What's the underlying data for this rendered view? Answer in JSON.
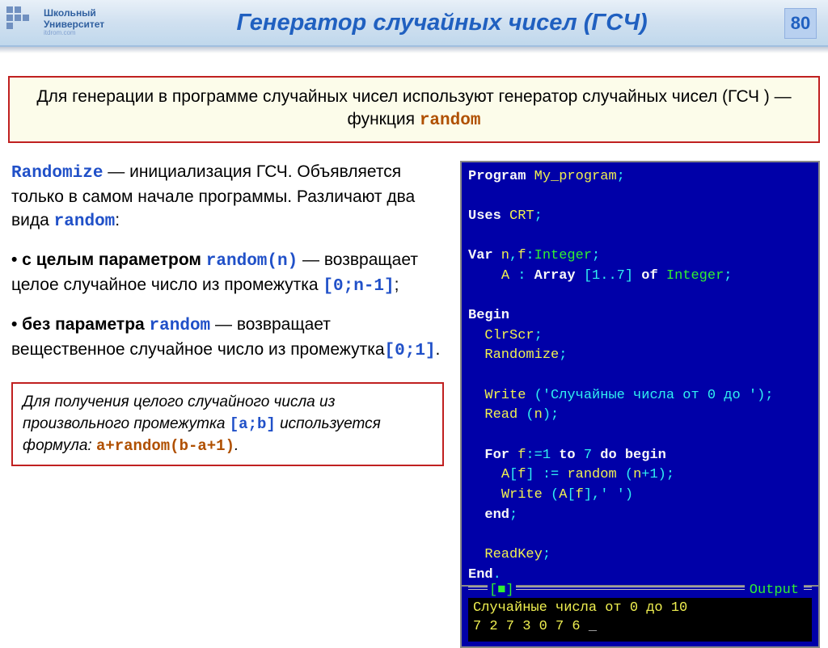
{
  "header": {
    "logo_line1": "Школьный",
    "logo_line2": "Университет",
    "logo_sub": "itdrom.com",
    "title": "Генератор случайных чисел  (ГСЧ)",
    "page_number": "80"
  },
  "intro": {
    "text_before": "Для генерации в программе случайных чисел используют генератор случайных чисел (ГСЧ ) — функция ",
    "keyword": "random"
  },
  "left": {
    "p1_kw": "Randomize",
    "p1_a": "  —   инициализация ГСЧ. Объявляется только в самом начале программы. Различают два вида ",
    "p1_kw2": "random",
    "p2_bold": "• с целым параметром ",
    "p2_kw": "random(n)",
    "p2_t": " — возвращает целое случайное число из промежутка ",
    "p2_range": "[0;n-1]",
    "p3_bold": "• без параметра ",
    "p3_kw": "random",
    "p3_t": " — возвращает вещественное случайное число из промежутка",
    "p3_range": "[0;1]",
    "note_a": "Для получения целого случайного числа из произвольного промежутка ",
    "note_range": "[a;b]",
    "note_b": " используется формула: ",
    "note_formula": "a+random(b-a+1)"
  },
  "code": {
    "l1_kw": "Program",
    "l1_id": " My_program",
    "l2_kw": "Uses",
    "l2_id": " CRT",
    "l3_kw": "Var",
    "l3_id": " n",
    "l3_id2": "f",
    "l3_ty": "Integer",
    "l4_id": "A",
    "l4_kw": "Array",
    "l4_rng": "[1..7]",
    "l4_of": "of",
    "l4_ty": "Integer",
    "l5_kw": "Begin",
    "l6_id": "ClrScr",
    "l7_id": "Randomize",
    "l8_id": "Write",
    "l8_str": "'Случайные числа от 0 до '",
    "l9_id": "Read",
    "l9_arg": "n",
    "l10_kw": "For",
    "l10_id": "f",
    "l10_n1": "1",
    "l10_to": "to",
    "l10_n2": "7",
    "l10_do": "do",
    "l10_beg": "begin",
    "l11_a": "A",
    "l11_f": "f",
    "l11_rnd": "random",
    "l11_n": "n",
    "l11_one": "1",
    "l12_id": "Write",
    "l12_a": "A",
    "l12_f": "f",
    "l12_sp": "' '",
    "l13_kw": "end",
    "l14_id": "ReadKey",
    "l15_kw": "End"
  },
  "output": {
    "frame_label": "Output",
    "marker": "[■]",
    "line1": "Случайные числа от 0 до 10",
    "line2": "7 2 7 3 0 7 6 ",
    "cursor": "_"
  }
}
